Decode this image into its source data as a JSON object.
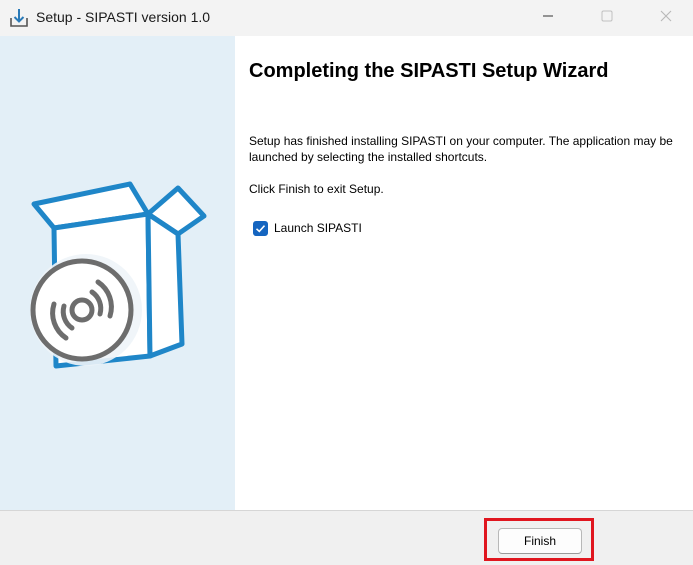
{
  "window": {
    "title": "Setup - SIPASTI version 1.0",
    "icon": "installer-download-icon"
  },
  "controls": {
    "minimize_icon": "minimize-icon",
    "maximize_icon": "maximize-icon",
    "close_icon": "close-icon"
  },
  "sidebar": {
    "graphic": "software-box-disc-icon",
    "accent_color": "#1f86c8",
    "background_color": "#e3eff7"
  },
  "main": {
    "heading": "Completing the SIPASTI Setup Wizard",
    "paragraph1": "Setup has finished installing SIPASTI on your computer. The application may be launched by selecting the installed shortcuts.",
    "paragraph2": "Click Finish to exit Setup.",
    "launch_checkbox": {
      "label": "Launch SIPASTI",
      "checked": true
    }
  },
  "footer": {
    "finish_label": "Finish",
    "highlight_color": "#e0161f"
  }
}
